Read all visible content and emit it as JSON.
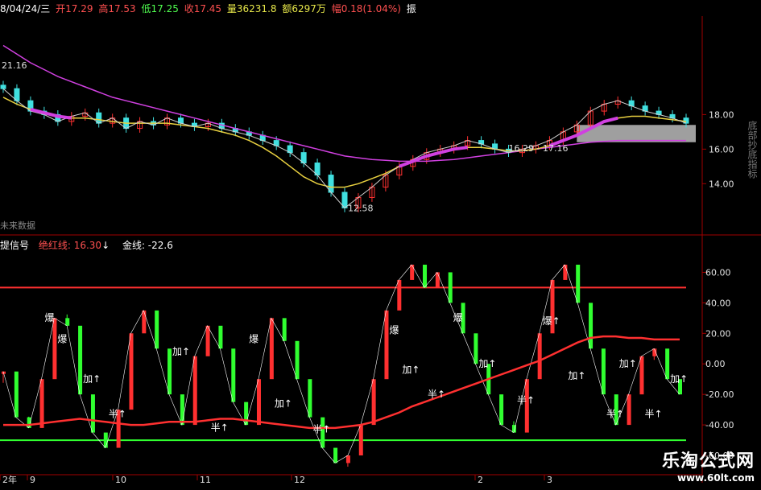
{
  "header": {
    "date": "8/04/24/三",
    "open": "开17.29",
    "high": "高17.53",
    "low": "低17.25",
    "close": "收17.45",
    "volume": "量36231.8",
    "amount": "额6297万",
    "change": "幅0.18(1.04%)",
    "more": "振"
  },
  "price_panel": {
    "right_axis_ticks": [
      "18.00",
      "16.00",
      "14.00"
    ],
    "annotations": {
      "left_value": "21.16",
      "low_mark": "12.58",
      "range_mark": "16.29 - 17.16"
    },
    "future_label": "未来数据",
    "right_side_text": "底部抄底指标"
  },
  "indicator_panel": {
    "title": "提信号",
    "line1_label": "绝红线: 16.30",
    "arrow": "↓",
    "line2_label": "金线: -22.6",
    "ticks": [
      "60.00",
      "40.00",
      "20.00",
      "0.00",
      "-20.00",
      "-40.00",
      "-60.00"
    ],
    "markers": [
      {
        "text": "爆"
      },
      {
        "text": "爆"
      },
      {
        "text": "加↑"
      },
      {
        "text": "半↑"
      },
      {
        "text": "加↑"
      },
      {
        "text": "半↑"
      },
      {
        "text": "爆"
      },
      {
        "text": "加↑"
      },
      {
        "text": "半↑"
      },
      {
        "text": "爆"
      },
      {
        "text": "加↑"
      },
      {
        "text": "半↑"
      },
      {
        "text": "爆"
      },
      {
        "text": "加↑"
      },
      {
        "text": "半↑"
      },
      {
        "text": "爆↑"
      },
      {
        "text": "加↑"
      },
      {
        "text": "半↑"
      },
      {
        "text": "加↑"
      },
      {
        "text": "半↑"
      },
      {
        "text": "加↑"
      }
    ]
  },
  "x_axis": {
    "labels": [
      "2年",
      "9",
      "10",
      "11",
      "12",
      "2",
      "3"
    ]
  },
  "watermark": {
    "title": "乐淘公式网",
    "url": "www.60lt.com"
  },
  "colors": {
    "up": "#ff3030",
    "down": "#30ff30",
    "ma_purple": "#d040e0",
    "ma_yellow": "#e8d040",
    "ma_white": "#d0d0d0",
    "level_red": "#ff3030",
    "level_green": "#30ff30",
    "grid_red": "#a00000"
  },
  "chart_data": {
    "type": "line",
    "price": {
      "yticks": [
        18,
        16,
        14
      ],
      "close_series": [
        19.5,
        18.8,
        18.2,
        18.0,
        17.6,
        17.9,
        18.1,
        17.5,
        17.8,
        17.2,
        17.6,
        17.4,
        17.8,
        17.5,
        17.3,
        17.5,
        17.2,
        17.0,
        16.8,
        16.5,
        16.2,
        15.8,
        15.2,
        14.5,
        13.5,
        12.6,
        13.2,
        13.8,
        14.5,
        15.0,
        15.4,
        15.8,
        16.0,
        16.2,
        16.5,
        16.3,
        16.0,
        15.8,
        16.0,
        16.2,
        16.5,
        17.0,
        17.4,
        18.2,
        18.6,
        18.8,
        18.5,
        18.2,
        18.0,
        17.8,
        17.5
      ],
      "ma_purple": [
        22,
        21.5,
        21,
        20.6,
        20.2,
        19.9,
        19.6,
        19.3,
        19.0,
        18.8,
        18.6,
        18.4,
        18.2,
        18.0,
        17.8,
        17.6,
        17.4,
        17.2,
        17.0,
        16.8,
        16.6,
        16.4,
        16.2,
        16.0,
        15.8,
        15.6,
        15.5,
        15.4,
        15.35,
        15.3,
        15.3,
        15.3,
        15.35,
        15.4,
        15.5,
        15.6,
        15.7,
        15.8,
        15.9,
        16.0,
        16.1,
        16.2,
        16.3,
        16.4,
        16.45,
        16.5,
        16.5,
        16.5,
        16.5,
        16.5,
        16.5
      ],
      "ma_yellow": [
        19.0,
        18.6,
        18.3,
        18.1,
        17.9,
        17.8,
        17.8,
        17.7,
        17.6,
        17.5,
        17.5,
        17.5,
        17.5,
        17.4,
        17.3,
        17.2,
        17.0,
        16.8,
        16.5,
        16.1,
        15.6,
        15.0,
        14.4,
        14.0,
        13.8,
        13.8,
        14.0,
        14.3,
        14.6,
        15.0,
        15.3,
        15.6,
        15.8,
        16.0,
        16.1,
        16.1,
        16.0,
        15.9,
        15.9,
        16.0,
        16.2,
        16.5,
        16.8,
        17.2,
        17.6,
        17.8,
        17.9,
        17.9,
        17.8,
        17.7,
        17.6
      ]
    },
    "indicator": {
      "yticks": [
        60,
        40,
        20,
        0,
        -20,
        -40,
        -60
      ],
      "upper_level": 50,
      "lower_level": -50,
      "oscillator": [
        -5,
        -35,
        -42,
        -10,
        30,
        25,
        -20,
        -45,
        -55,
        -30,
        20,
        35,
        10,
        -20,
        -40,
        5,
        25,
        10,
        -25,
        -40,
        -10,
        30,
        15,
        -10,
        -35,
        -55,
        -65,
        -60,
        -40,
        -10,
        35,
        55,
        65,
        50,
        60,
        40,
        20,
        0,
        -20,
        -40,
        -45,
        -10,
        20,
        55,
        65,
        40,
        10,
        -20,
        -40,
        -20,
        5,
        10,
        -10,
        -20
      ],
      "signal_red": [
        -40,
        -40,
        -40,
        -39,
        -38,
        -37,
        -36,
        -37,
        -38,
        -39,
        -40,
        -40,
        -39,
        -38,
        -38,
        -38,
        -37,
        -36,
        -36,
        -37,
        -38,
        -39,
        -40,
        -41,
        -42,
        -42,
        -42,
        -41,
        -40,
        -38,
        -35,
        -32,
        -28,
        -25,
        -22,
        -19,
        -16,
        -13,
        -10,
        -7,
        -4,
        -1,
        2,
        6,
        10,
        14,
        17,
        18,
        18,
        17,
        17,
        16,
        16,
        16
      ]
    },
    "x_labels": [
      "2年",
      "9",
      "10",
      "11",
      "12",
      "2",
      "3"
    ]
  }
}
